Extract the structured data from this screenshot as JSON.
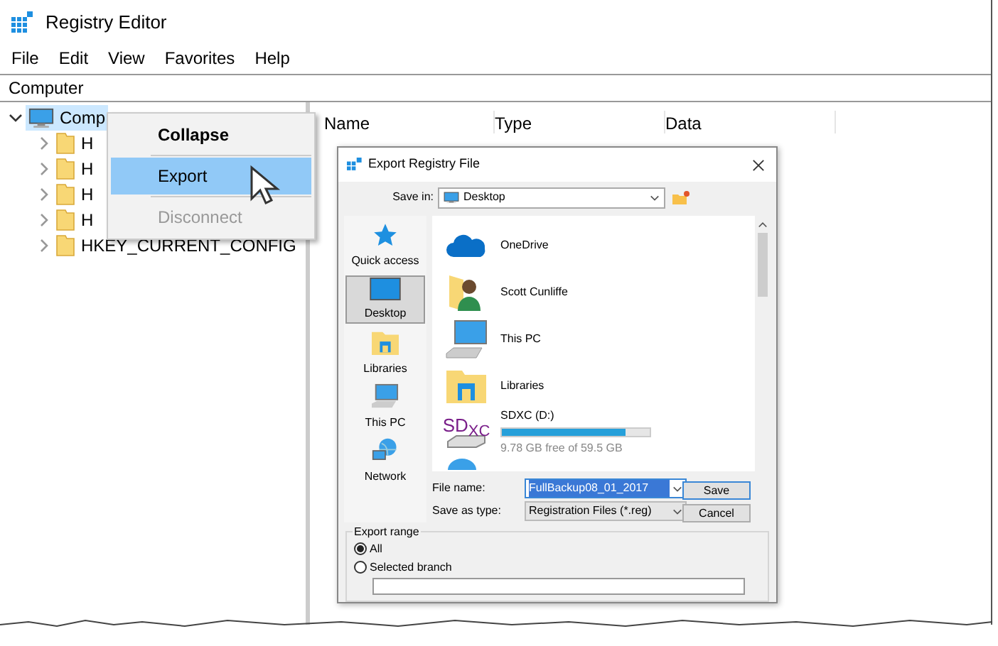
{
  "window": {
    "title": "Registry Editor"
  },
  "menu": [
    "File",
    "Edit",
    "View",
    "Favorites",
    "Help"
  ],
  "address": "Computer",
  "tree": {
    "label": "Comp",
    "expanded": true,
    "selected": true,
    "children": [
      {
        "label": "H",
        "expanded": false
      },
      {
        "label": "H",
        "expanded": false
      },
      {
        "label": "H",
        "expanded": false
      },
      {
        "label": "H",
        "expanded": false
      },
      {
        "label": "HKEY_CURRENT_CONFIG",
        "expanded": false
      }
    ]
  },
  "columns": [
    "Name",
    "Type",
    "Data"
  ],
  "context_menu": [
    {
      "label": "Collapse",
      "bold": true,
      "selected": false,
      "disabled": false
    },
    {
      "label": "Export",
      "bold": false,
      "selected": true,
      "disabled": false
    },
    {
      "label": "Disconnect",
      "bold": false,
      "selected": false,
      "disabled": true
    }
  ],
  "dialog": {
    "title": "Export Registry File",
    "save_in": {
      "label": "Save in:",
      "value": "Desktop"
    },
    "places": [
      {
        "label": "Quick access",
        "kind": "star",
        "selected": false
      },
      {
        "label": "Desktop",
        "kind": "desktop",
        "selected": true
      },
      {
        "label": "Libraries",
        "kind": "library",
        "selected": false
      },
      {
        "label": "This PC",
        "kind": "pc",
        "selected": false
      },
      {
        "label": "Network",
        "kind": "network",
        "selected": false
      }
    ],
    "files": [
      {
        "name": "OneDrive",
        "kind": "cloud"
      },
      {
        "name": "Scott Cunliffe",
        "kind": "user"
      },
      {
        "name": "This PC",
        "kind": "pc"
      },
      {
        "name": "Libraries",
        "kind": "library"
      },
      {
        "name": "SDXC (D:)",
        "kind": "drive",
        "level": 0.84,
        "detail": "9.78 GB free of 59.5 GB",
        "badge": "SD",
        "badge_sub": "XC"
      }
    ],
    "file_name": {
      "label": "File name:",
      "value": "FullBackup08_01_2017"
    },
    "save_type": {
      "label": "Save as type:",
      "value": "Registration Files (*.reg)"
    },
    "buttons": [
      {
        "label": "Save",
        "default": true
      },
      {
        "label": "Cancel",
        "default": false
      }
    ],
    "export_range": {
      "title": "Export range",
      "options": [
        {
          "label": "All",
          "selected": true
        },
        {
          "label": "Selected branch",
          "selected": false
        }
      ]
    }
  }
}
